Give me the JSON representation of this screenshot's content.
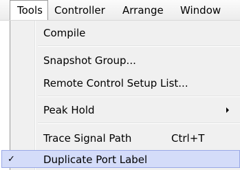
{
  "menubar": {
    "items": [
      "Tools",
      "Controller",
      "Arrange",
      "Window"
    ]
  },
  "menu": {
    "items": [
      {
        "label": "Compile"
      },
      {
        "label": "Snapshot Group..."
      },
      {
        "label": "Remote Control Setup List..."
      },
      {
        "label": "Peak Hold",
        "has_submenu": true
      },
      {
        "label": "Trace Signal Path",
        "shortcut": "Ctrl+T"
      },
      {
        "label": "Duplicate Port Label",
        "checked": true,
        "check_symbol": "✓"
      }
    ]
  }
}
